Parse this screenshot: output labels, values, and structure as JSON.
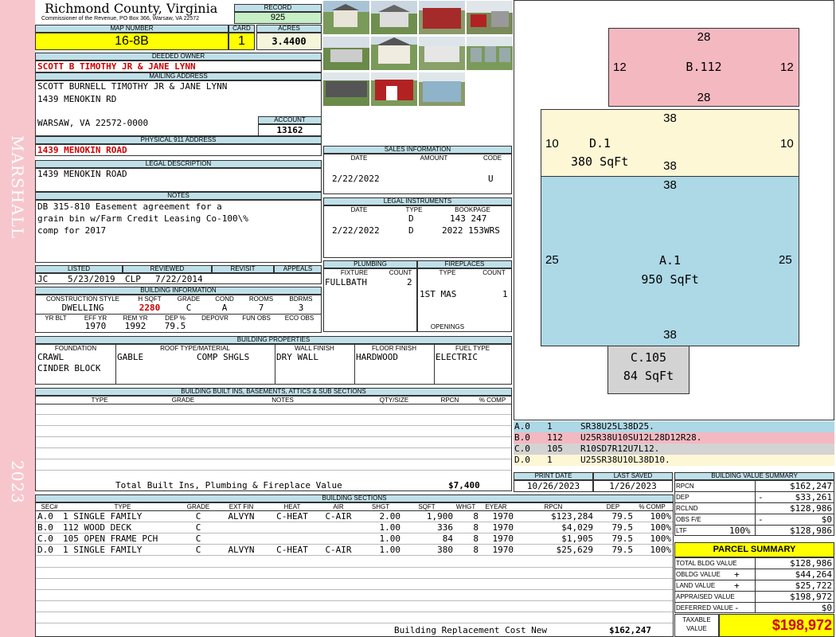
{
  "sidebar": {
    "district": "MARSHALL",
    "year": "2023"
  },
  "header": {
    "county": "Richmond County, Virginia",
    "commissioner": "Commissioner of the Revenue, PO Box 366, Warsaw, VA 22572",
    "record_label": "RECORD",
    "record": "925",
    "map_label": "MAP NUMBER",
    "map_number": "16-8B",
    "card_label": "CARD",
    "card": "1",
    "acres_label": "ACRES",
    "acres": "3.4400"
  },
  "owner": {
    "deeded_label": "DEEDED OWNER",
    "deeded": "SCOTT B TIMOTHY JR & JANE LYNN",
    "mailing_label": "MAILING ADDRESS",
    "mail1": "SCOTT BURNELL TIMOTHY JR & JANE LYNN",
    "mail2": "1439 MENOKIN RD",
    "mail3": "WARSAW, VA 22572-0000",
    "account_label": "ACCOUNT",
    "account": "13162",
    "physical_label": "PHYSICAL 911 ADDRESS",
    "physical": "1439 MENOKIN ROAD",
    "legal_label": "LEGAL DESCRIPTION",
    "legal": "1439 MENOKIN ROAD",
    "notes_label": "NOTES",
    "notes1": "DB 315-810 Easement agreement for a",
    "notes2": "grain bin w/Farm Credit Leasing Co-100\\%",
    "notes3": "comp for 2017"
  },
  "listed": {
    "h_listed": "LISTED",
    "h_reviewed": "REVIEWED",
    "h_revisit": "REVISIT",
    "h_appeals": "APPEALS",
    "listed_by": "JC",
    "listed_date": "5/23/2019",
    "reviewed_by": "CLP",
    "reviewed_date": "7/22/2014"
  },
  "building_info": {
    "label": "BUILDING INFORMATION",
    "h": [
      "CONSTRUCTION STYLE",
      "H SQFT",
      "GRADE",
      "COND",
      "ROOMS",
      "BDRMS"
    ],
    "style": "DWELLING",
    "hsqft": "2280",
    "grade": "C",
    "cond": "A",
    "rooms": "7",
    "bdrms": "3",
    "h2": [
      "YR BLT",
      "EFF YR",
      "REM YR",
      "DEP %",
      "DEPOVR",
      "FUN OBS",
      "ECO OBS"
    ],
    "yrblt": "",
    "effyr": "1970",
    "remyr": "1992",
    "dep": "79.5"
  },
  "sales": {
    "label": "SALES INFORMATION",
    "h": [
      "DATE",
      "AMOUNT",
      "CODE"
    ],
    "date": "2/22/2022",
    "code": "U"
  },
  "legal_instr": {
    "label": "LEGAL INSTRUMENTS",
    "h": [
      "DATE",
      "TYPE",
      "BOOKPAGE"
    ],
    "rows": [
      {
        "date": "",
        "type": "D",
        "book": "143 247"
      },
      {
        "date": "2/22/2022",
        "type": "D",
        "book": "2022 153WRS"
      }
    ]
  },
  "plumbing": {
    "label": "PLUMBING",
    "h": [
      "FIXTURE",
      "COUNT"
    ],
    "fixture": "FULLBATH",
    "count": "2"
  },
  "fireplaces": {
    "label": "FIREPLACES",
    "h": [
      "TYPE",
      "COUNT"
    ],
    "type": "1ST MAS",
    "count": "1",
    "openings": "OPENINGS"
  },
  "props": {
    "label": "BUILDING PROPERTIES",
    "h": [
      "FOUNDATION",
      "ROOF TYPE/MATERIAL",
      "WALL FINISH",
      "FLOOR FINISH",
      "FUEL TYPE"
    ],
    "foundation1": "CRAWL",
    "foundation2": "CINDER BLOCK",
    "roof_type": "GABLE",
    "roof_mat": "COMP SHGLS",
    "wall": "DRY WALL",
    "floor": "HARDWOOD",
    "fuel": "ELECTRIC"
  },
  "builtins": {
    "label": "BUILDING BUILT INS, BASEMENTS, ATTICS & SUB SECTIONS",
    "h": [
      "TYPE",
      "GRADE",
      "NOTES",
      "QTY/SIZE",
      "RPCN",
      "% COMP"
    ],
    "total_label": "Total Built Ins, Plumbing & Fireplace Value",
    "total": "$7,400"
  },
  "print": {
    "h_print": "PRINT DATE",
    "h_saved": "LAST SAVED",
    "print_date": "10/26/2023",
    "last_saved": "1/26/2023"
  },
  "sections": {
    "label": "BUILDING SECTIONS",
    "h": [
      "SEC#",
      "TYPE",
      "GRADE",
      "EXT FIN",
      "HEAT",
      "AIR",
      "SHGT",
      "SQFT",
      "WHGT",
      "EYEAR",
      "RPCN",
      "DEP",
      "% COMP"
    ],
    "rows": [
      {
        "sec": "A.0",
        "type": "1 SINGLE FAMILY",
        "grade": "C",
        "ext": "ALVYN",
        "heat": "C-HEAT",
        "air": "C-AIR",
        "shgt": "2.00",
        "sqft": "1,900",
        "whgt": "8",
        "eyear": "1970",
        "rpcn": "$123,284",
        "dep": "79.5",
        "comp": "100%"
      },
      {
        "sec": "B.0",
        "type": "112 WOOD DECK",
        "grade": "C",
        "ext": "",
        "heat": "",
        "air": "",
        "shgt": "1.00",
        "sqft": "336",
        "whgt": "8",
        "eyear": "1970",
        "rpcn": "$4,029",
        "dep": "79.5",
        "comp": "100%"
      },
      {
        "sec": "C.0",
        "type": "105 OPEN FRAME PCH",
        "grade": "C",
        "ext": "",
        "heat": "",
        "air": "",
        "shgt": "1.00",
        "sqft": "84",
        "whgt": "8",
        "eyear": "1970",
        "rpcn": "$1,905",
        "dep": "79.5",
        "comp": "100%"
      },
      {
        "sec": "D.0",
        "type": "1 SINGLE FAMILY",
        "grade": "C",
        "ext": "ALVYN",
        "heat": "C-HEAT",
        "air": "C-AIR",
        "shgt": "1.00",
        "sqft": "380",
        "whgt": "8",
        "eyear": "1970",
        "rpcn": "$25,629",
        "dep": "79.5",
        "comp": "100%"
      }
    ],
    "replacement_label": "Building Replacement Cost New",
    "replacement": "$162,247"
  },
  "sketch": {
    "B": {
      "top": "28",
      "bottom": "28",
      "left": "12",
      "right": "12",
      "label": "B.112"
    },
    "D": {
      "top": "38",
      "bottom": "38",
      "left": "10",
      "right": "10",
      "label": "D.1",
      "area": "380 SqFt"
    },
    "A": {
      "top": "38",
      "bottom": "38",
      "left": "25",
      "right": "25",
      "label": "A.1",
      "area": "950 SqFt"
    },
    "C": {
      "label": "C.105",
      "area": "84 SqFt"
    }
  },
  "sketch_codes": [
    {
      "id": "A.0",
      "n": "1",
      "code": "SR38U25L38D25.",
      "color": "#add8e6"
    },
    {
      "id": "B.0",
      "n": "112",
      "code": "U25R38U10SU12L28D12R28.",
      "color": "#f4b8c1"
    },
    {
      "id": "C.0",
      "n": "105",
      "code": "R10SD7R12U7L12.",
      "color": "#d3d3d3"
    },
    {
      "id": "D.0",
      "n": "1",
      "code": "U25SR38U10L38D10.",
      "color": "#fdf7d6"
    }
  ],
  "bvs": {
    "label": "BUILDING VALUE SUMMARY",
    "rpcn_l": "RPCN",
    "rpcn": "$162,247",
    "dep_l": "DEP",
    "dep_s": "-",
    "dep": "$33,261",
    "rclnd_l": "RCLND",
    "rclnd": "$128,986",
    "obs_l": "OBS F/E",
    "obs_s": "-",
    "obs": "$0",
    "ltf_l": "LTF",
    "ltf_pct": "100%",
    "ltf": "$128,986"
  },
  "parcel": {
    "label": "PARCEL SUMMARY",
    "bldg_l": "TOTAL BLDG VALUE",
    "bldg": "$128,986",
    "obldg_l": "OBLDG VALUE",
    "obldg_s": "+",
    "obldg": "$44,264",
    "land_l": "LAND VALUE",
    "land_s": "+",
    "land": "$25,722",
    "appr_l": "APPRAISED VALUE",
    "appr": "$198,972",
    "def_l": "DEFERRED VALUE",
    "def_s": "-",
    "def": "$0",
    "tax_l1": "TAXABLE",
    "tax_l2": "VALUE",
    "tax": "$198,972"
  },
  "colors": {
    "header": "#bfe0e9",
    "yellow": "#ffff00",
    "green": "#c6efc6",
    "pink": "#f7c6cc",
    "red": "#d00000"
  }
}
